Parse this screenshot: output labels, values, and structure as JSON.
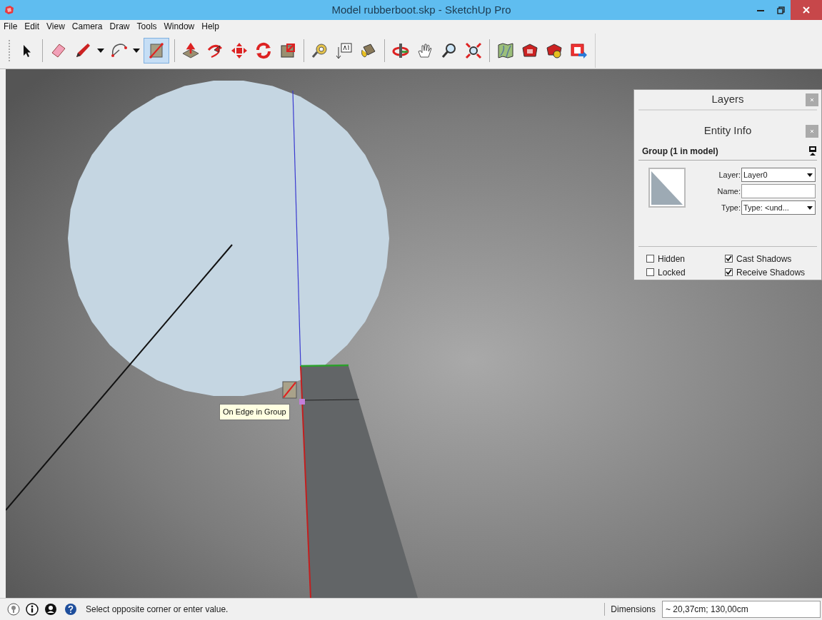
{
  "window": {
    "title": "Model rubberboot.skp - SketchUp Pro"
  },
  "menu": [
    "File",
    "Edit",
    "View",
    "Camera",
    "Draw",
    "Tools",
    "Window",
    "Help"
  ],
  "toolbar": [
    {
      "kind": "tool",
      "selected": false
    },
    {
      "kind": "separator"
    },
    {
      "kind": "tool",
      "selected": false
    },
    {
      "kind": "tool",
      "selected": false
    },
    {
      "kind": "dropdown"
    },
    {
      "kind": "tool",
      "selected": false
    },
    {
      "kind": "dropdown"
    },
    {
      "kind": "tool",
      "selected": true
    },
    {
      "kind": "separator"
    },
    {
      "kind": "tool",
      "selected": false
    },
    {
      "kind": "tool",
      "selected": false
    },
    {
      "kind": "tool",
      "selected": false
    },
    {
      "kind": "tool",
      "selected": false
    },
    {
      "kind": "tool",
      "selected": false
    },
    {
      "kind": "separator"
    },
    {
      "kind": "tool",
      "selected": false
    },
    {
      "kind": "tool",
      "selected": false
    },
    {
      "kind": "tool",
      "selected": false
    },
    {
      "kind": "separator"
    },
    {
      "kind": "tool",
      "selected": false
    },
    {
      "kind": "tool",
      "selected": false
    },
    {
      "kind": "tool",
      "selected": false
    },
    {
      "kind": "tool",
      "selected": false
    },
    {
      "kind": "separator"
    },
    {
      "kind": "tool",
      "selected": false
    },
    {
      "kind": "tool",
      "selected": false
    },
    {
      "kind": "tool",
      "selected": false
    },
    {
      "kind": "tool",
      "selected": false
    }
  ],
  "viewport": {
    "tooltip": "On Edge in Group"
  },
  "layers_panel": {
    "title": "Layers"
  },
  "entity_info": {
    "title": "Entity Info",
    "heading": "Group (1 in model)",
    "fields": [
      {
        "label": "Layer:",
        "value": "Layer0",
        "kind": "dropdown"
      },
      {
        "label": "Name:",
        "kind": "text"
      },
      {
        "label": "Type:",
        "value": "Type: <und...",
        "kind": "dropdown"
      }
    ],
    "options": [
      {
        "label": "Hidden",
        "checked": false
      },
      {
        "label": "Cast Shadows",
        "checked": true
      },
      {
        "label": "Locked",
        "checked": false
      },
      {
        "label": "Receive Shadows",
        "checked": true
      }
    ]
  },
  "status_bar": {
    "message": "Select opposite corner or enter value.",
    "measure_label": "Dimensions",
    "measure_value": "~ 20,37cm; 130,00cm"
  }
}
